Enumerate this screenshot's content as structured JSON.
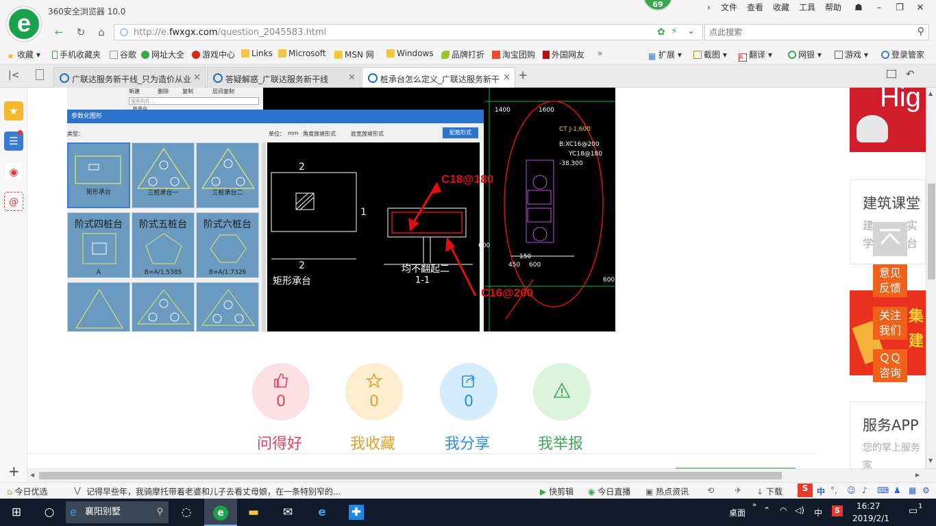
{
  "browser": {
    "title": "360安全浏览器 10.0",
    "badge": "69",
    "menu": [
      "文件",
      "查看",
      "收藏",
      "工具",
      "帮助"
    ],
    "url_prefix": "http://e.",
    "url_domain": "fwxgx.com",
    "url_path": "/question_2045583.html",
    "search_placeholder": "点此搜索"
  },
  "bookmarks": {
    "left": [
      "收藏",
      "手机收藏夹",
      "谷歌",
      "网址大全",
      "游戏中心",
      "Links",
      "Microsoft",
      "MSN 网",
      "Windows",
      "品牌打折",
      "淘宝团购",
      "外国网友"
    ],
    "more": "»",
    "right": [
      "扩展",
      "截图",
      "翻译",
      "网银",
      "游戏",
      "登录管家"
    ]
  },
  "tabs": [
    {
      "label": "广联达服务新干线_只为造价从业"
    },
    {
      "label": "答疑解惑_广联达服务新干线"
    },
    {
      "label": "桩承台怎么定义_广联达服务新干"
    }
  ],
  "image": {
    "dialog_title": "参数化图形",
    "type_label": "类型：",
    "unit_label": "单位：",
    "unit_value": "mm",
    "radio1": "角度放坡形式",
    "radio2": "底宽放坡形式",
    "config_button": "配筋形式",
    "shapes": [
      {
        "title": "",
        "label": "矩形承台"
      },
      {
        "title": "",
        "label": "三桩承台一"
      },
      {
        "title": "",
        "label": "三桩承台二"
      },
      {
        "title": "阶式四桩台",
        "label": "A"
      },
      {
        "title": "阶式五桩台",
        "label": "B=A/1.5385"
      },
      {
        "title": "阶式六桩台",
        "label": "B=A/1.7326"
      }
    ],
    "cad_labels": {
      "n2_top": "2",
      "n1": "1",
      "n2_bottom": "2",
      "rect_base": "矩形承台",
      "no_bend": "均不翻起二",
      "section": "1-1",
      "dim1": "1400",
      "dim2": "1600",
      "ct": "CT J-1,600",
      "bx": "B:XC16@200",
      "yc": "YC18@180",
      "elev": "-38.300",
      "d150": "150",
      "d450": "450",
      "d600": "600",
      "d600b": "600",
      "d600c": "600"
    },
    "annotation1": "C18@180",
    "annotation2": "C16@200",
    "top_menu": [
      "新建",
      "删除",
      "复制",
      "层间复制"
    ],
    "search_hint": "搜索构件...",
    "tree_item": "桩承台"
  },
  "actions": [
    {
      "count": "0",
      "label": "问得好",
      "color": "#e0445c",
      "bg": "#fde0e4",
      "icon": "thumbs-up-icon"
    },
    {
      "count": "0",
      "label": "我收藏",
      "color": "#e0a22c",
      "bg": "#fdedcf",
      "icon": "star-icon"
    },
    {
      "count": "0",
      "label": "我分享",
      "color": "#2f8ee0",
      "bg": "#d4ecfc",
      "icon": "share-icon"
    },
    {
      "count": "0",
      "label": "我举报",
      "color": "#3fa855",
      "bg": "#dcf3dc",
      "icon": "warning-icon"
    }
  ],
  "right_panel": {
    "banner_text": "Hig",
    "course_title": "建筑课堂",
    "course_sub1": "建",
    "course_sub1b": "实",
    "course_sub2": "学",
    "course_sub2b": "台",
    "app_title": "服务APP",
    "app_sub1": "您的掌上服务",
    "app_sub2": "家",
    "banner2_text": "集",
    "banner2_text2": "建"
  },
  "float_buttons": [
    {
      "line1": "意见",
      "line2": "反馈"
    },
    {
      "line1": "关注",
      "line2": "我们"
    },
    {
      "line1": "ＱＱ",
      "line2": "咨询"
    }
  ],
  "statusbar": {
    "today": "今日优选",
    "news": "记得早些年，我骑摩托带着老婆和儿子去看丈母娘，在一条特别窄的...",
    "items": [
      "快剪辑",
      "今日直播",
      "热点资讯",
      "下载"
    ],
    "ime": "中"
  },
  "taskbar": {
    "search_text": "襄阳别墅",
    "desktop": "桌面",
    "ime": "中",
    "time": "16:27",
    "date": "2019/2/1",
    "notifications": "1"
  },
  "colors": {
    "accent_green": "#3aa84b",
    "float_orange": "#f0621a",
    "annotation_red": "#e01010"
  }
}
